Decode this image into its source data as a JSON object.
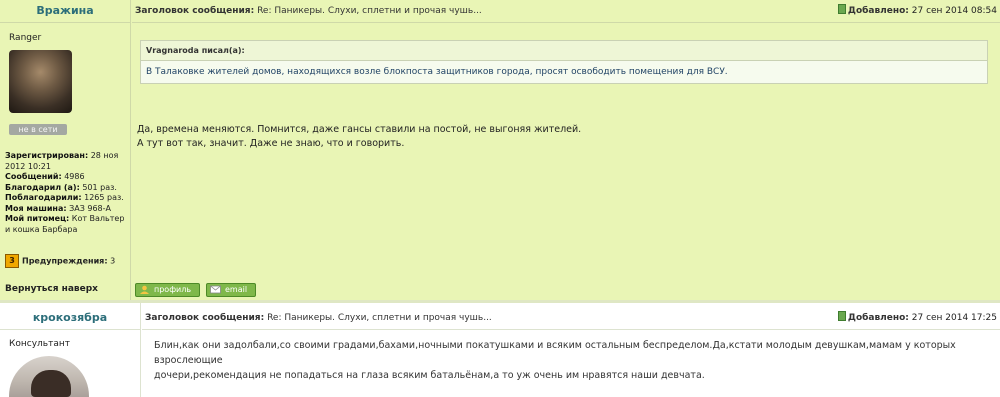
{
  "posts": [
    {
      "author": "Вражина",
      "rank": "Ranger",
      "status": "не в сети",
      "subject_label": "Заголовок сообщения:",
      "subject": "Re: Паникеры. Слухи, сплетни и прочая чушь...",
      "added_label": "Добавлено:",
      "date": "27 сен 2014 08:54",
      "stats": {
        "registered_label": "Зарегистрирован:",
        "registered": "28 ноя 2012 10:21",
        "messages_label": "Сообщений:",
        "messages": "4986",
        "thanked_label": "Благодарил (а):",
        "thanked": "501 раз.",
        "was_thanked_label": "Поблагодарили:",
        "was_thanked": "1265 раз.",
        "car_label": "Моя машина:",
        "car": "ЗАЗ 968-А",
        "pet_label": "Мой питомец:",
        "pet": "Кот Вальтер и кошка Барбара",
        "warnings_label": "Предупреждения:",
        "warnings": "3",
        "warning_badge": "3"
      },
      "quote": {
        "header": "Vragnaroda писал(а):",
        "text": "В Талаковке жителей домов, находящихся возле блокпоста защитников города, просят освободить помещения для ВСУ."
      },
      "body_lines": [
        "Да, времена меняются. Помнится, даже гансы ставили на постой, не выгоняя жителей.",
        "А тут вот так, значит. Даже не знаю, что и говорить."
      ],
      "back_to_top": "Вернуться наверх",
      "profile_button": "профиль",
      "email_button": "email"
    },
    {
      "author": "крокозябра",
      "rank": "Консультант",
      "subject_label": "Заголовок сообщения:",
      "subject": "Re: Паникеры. Слухи, сплетни и прочая чушь...",
      "added_label": "Добавлено:",
      "date": "27 сен 2014 17:25",
      "body_lines": [
        "Блин,как они задолбали,со своими градами,бахами,ночными покатушками и всяким остальным беспределом.Да,кстати молодым девушкам,мамам у которых взрослеющие",
        "дочери,рекомендация не попадаться на глаза всяким батальёнам,а то уж очень им нравятся наши девчата."
      ]
    }
  ],
  "colors": {
    "post_bg": "#e9f5b5",
    "author": "#2c6e7a",
    "button": "#7fb84a"
  }
}
